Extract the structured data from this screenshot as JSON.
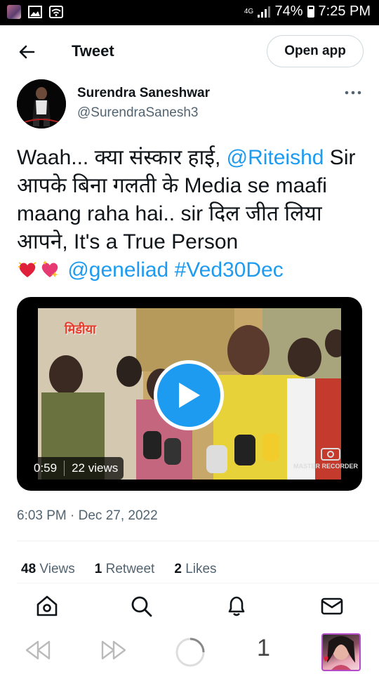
{
  "status_bar": {
    "network": "4G",
    "battery": "74%",
    "time": "7:25 PM"
  },
  "header": {
    "title": "Tweet",
    "open_app_label": "Open app"
  },
  "author": {
    "name": "Surendra Saneshwar",
    "handle": "@SurendraSanesh3"
  },
  "tweet": {
    "text_1": "Waah... क्या संस्कार हाई, ",
    "mention_1": "@Riteishd",
    "text_2": " Sir आपके बिना गलती के Media se maafi maang raha hai..  sir दिल जीत लिया आपने, It's a True Person ",
    "mention_2": "@geneliad",
    "hashtag": "#Ved30Dec"
  },
  "media": {
    "duration": "0:59",
    "views": "22 views",
    "watermark": "MASTER RECORDER",
    "channel_logo": "मिडीया"
  },
  "timestamp": "6:03 PM · Dec 27, 2022",
  "stats": {
    "views_count": "48",
    "views_label": "Views",
    "retweets_count": "1",
    "retweets_label": "Retweet",
    "likes_count": "2",
    "likes_label": "Likes"
  },
  "browser": {
    "tab_count": "1"
  },
  "colors": {
    "accent": "#1d9bf0",
    "text": "#0f1419",
    "secondary": "#536471"
  }
}
